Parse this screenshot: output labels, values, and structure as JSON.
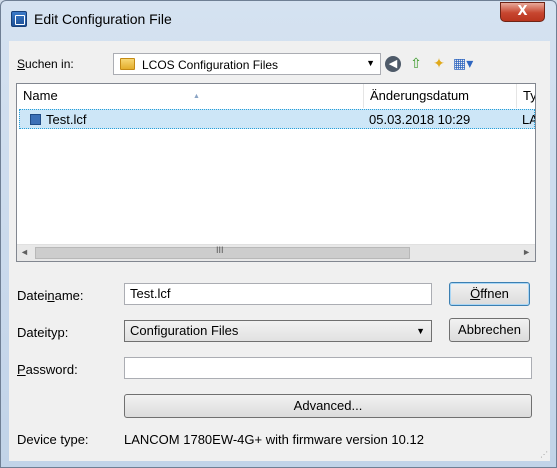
{
  "window": {
    "title": "Edit Configuration File",
    "close_label": "X"
  },
  "lookin": {
    "label_prefix": "",
    "label_u": "S",
    "label_rest": "uchen in:",
    "value": "LCOS Configuration Files"
  },
  "toolbar": {
    "back_glyph": "◀",
    "up_glyph": "⇧",
    "newfolder_glyph": "✦",
    "view_glyph": "▦▾"
  },
  "filelist": {
    "columns": [
      "Name",
      "Änderungsdatum",
      "Ty"
    ],
    "rows": [
      {
        "name": "Test.lcf",
        "date": "05.03.2018 10:29",
        "type": "LA"
      }
    ],
    "scroll_left": "◄",
    "scroll_right": "►",
    "scroll_grip": "III"
  },
  "filename": {
    "label_a": "Datei",
    "label_u": "n",
    "label_b": "ame:",
    "value": "Test.lcf"
  },
  "filetype": {
    "label": "Dateityp:",
    "value": "Configuration Files"
  },
  "password": {
    "label_u": "P",
    "label_rest": "assword:",
    "value": ""
  },
  "buttons": {
    "open_a": "Ö",
    "open_b": "ffnen",
    "cancel": "Abbrechen",
    "advanced": "Advanced..."
  },
  "device": {
    "label": "Device type:",
    "value": "LANCOM 1780EW-4G+ with firmware version 10.12"
  },
  "icons": [
    "app-icon",
    "close-icon",
    "folder-icon",
    "back-icon",
    "up-folder-icon",
    "new-folder-icon",
    "view-menu-icon",
    "file-icon",
    "dropdown-arrow-icon",
    "resize-grip-icon"
  ]
}
